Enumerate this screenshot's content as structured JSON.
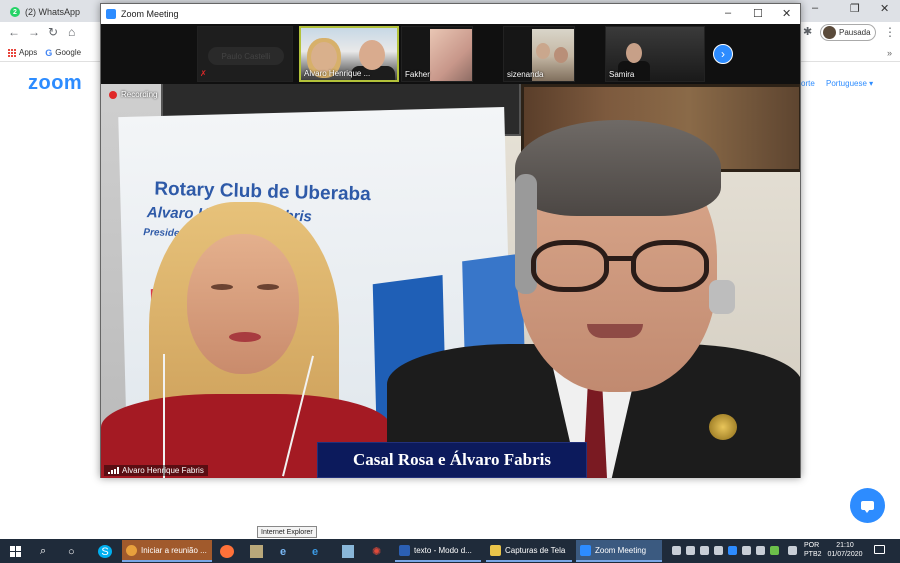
{
  "browser": {
    "tab_title": "(2) WhatsApp",
    "tab_badge": "2",
    "minimize": "–",
    "restore": "❐",
    "close": "✕",
    "back": "←",
    "forward": "→",
    "reload": "↻",
    "home": "⌂",
    "extensions": "✱",
    "profile_status": "Pausada",
    "menu": "⋮",
    "bookmarks": [
      {
        "label": "Apps"
      },
      {
        "label": "Google"
      }
    ],
    "bookmarks_more": "»"
  },
  "website": {
    "logo": "zoom",
    "support_link": "orte",
    "language": "Portuguese ▾"
  },
  "zoom_window": {
    "title": "Zoom Meeting",
    "minimize": "–",
    "maximize": "☐",
    "close": "✕",
    "gallery": [
      {
        "name": "",
        "muted": true,
        "hidden_name": "Paulo Castelli"
      },
      {
        "name": "Alvaro Henrique ..."
      },
      {
        "name": "Fakher"
      },
      {
        "name": "sizenanda"
      },
      {
        "name": "Samira"
      }
    ],
    "gallery_next": "›",
    "recording_label": "Recording",
    "active_speaker": "Alvaro Henrique Fabris",
    "banner": {
      "line1": "Rotary Club de Uberaba",
      "line2": "Alvaro Henrique Fabris",
      "line3": "Presidente"
    },
    "caption": "Casal Rosa e Álvaro Fabris"
  },
  "tooltip": "Internet Explorer",
  "taskbar": {
    "apps": [
      {
        "label": "Iniciar a reunião ...",
        "color": "#e8a03c"
      },
      {
        "label": "texto - Modo d...",
        "color": "#2b5fb3"
      },
      {
        "label": "Capturas de Tela",
        "color": "#e9c44a"
      },
      {
        "label": "Zoom Meeting",
        "color": "#2d8cff"
      }
    ],
    "lang_line1": "POR",
    "lang_line2": "PTB2",
    "time": "21:10",
    "date": "01/07/2020"
  },
  "colors": {
    "zoom_blue": "#2d8cff",
    "taskbar": "#1f2b3a",
    "caption_bg": "#0c1a5c",
    "recording_red": "#e02828"
  }
}
